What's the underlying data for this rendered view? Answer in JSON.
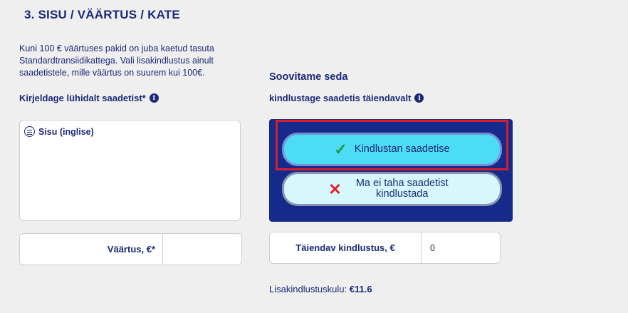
{
  "section_title": "3. SISU / VÄÄRTUS / KATE",
  "info_text": "Kuni 100 € väärtuses pakid on juba kaetud tasuta Standardtransiidikattega. Vali lisakindlustus ainult saadetistele, mille väärtus on suurem kui 100€.",
  "description_label": "Kirjeldage lühidalt saadetist*",
  "insurance_heading": "Soovitame seda",
  "insurance_label": "kindlustage saadetis täiendavalt",
  "content_textarea": {
    "header": "Sisu (inglise)",
    "value": ""
  },
  "value_field": {
    "label": "Väärtus, €*",
    "value": ""
  },
  "insure_yes_button": "Kindlustan saadetise",
  "insure_no_button": "Ma ei taha saadetist kindlustada",
  "extra_insurance_field": {
    "label": "Täiendav kindlustus, €",
    "value": "0"
  },
  "cost": {
    "label": "Lisakindlustuskulu:",
    "amount": "€11.6"
  },
  "colors": {
    "navy": "#1b2a78",
    "panel": "#152a8a",
    "accent": "#4ddcf5",
    "highlight": "#d61f2a"
  },
  "icons": {
    "info": "info-icon",
    "list": "list-icon",
    "check": "check-icon",
    "cross": "cross-icon"
  }
}
